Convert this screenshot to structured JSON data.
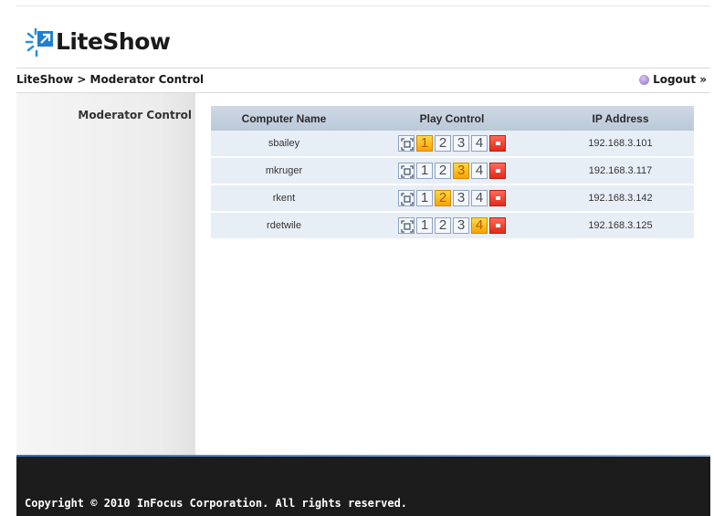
{
  "app": {
    "name": "LiteShow"
  },
  "header": {
    "breadcrumb": "LiteShow > Moderator Control",
    "logout_label": "Logout »"
  },
  "sidebar": {
    "items": [
      {
        "label": "Moderator Control"
      }
    ]
  },
  "table": {
    "columns": [
      "Computer Name",
      "Play Control",
      "IP Address"
    ],
    "buttons": [
      "1",
      "2",
      "3",
      "4"
    ],
    "rows": [
      {
        "name": "sbailey",
        "active": 1,
        "ip": "192.168.3.101"
      },
      {
        "name": "mkruger",
        "active": 3,
        "ip": "192.168.3.117"
      },
      {
        "name": "rkent",
        "active": 2,
        "ip": "192.168.3.142"
      },
      {
        "name": "rdetwile",
        "active": 4,
        "ip": "192.168.3.125"
      }
    ]
  },
  "footer": {
    "copyright": "Copyright © 2010 InFocus Corporation. All rights reserved."
  },
  "colors": {
    "accent": "#f5a400",
    "stop": "#e02a1c",
    "footer_bg": "#1c1c1c",
    "table_header": "#bac8d8"
  },
  "icons": {
    "logo": "liteshow-sparkle-icon",
    "logout": "logout-orb-icon",
    "fullscreen": "fullscreen-icon",
    "stop": "stop-icon"
  }
}
